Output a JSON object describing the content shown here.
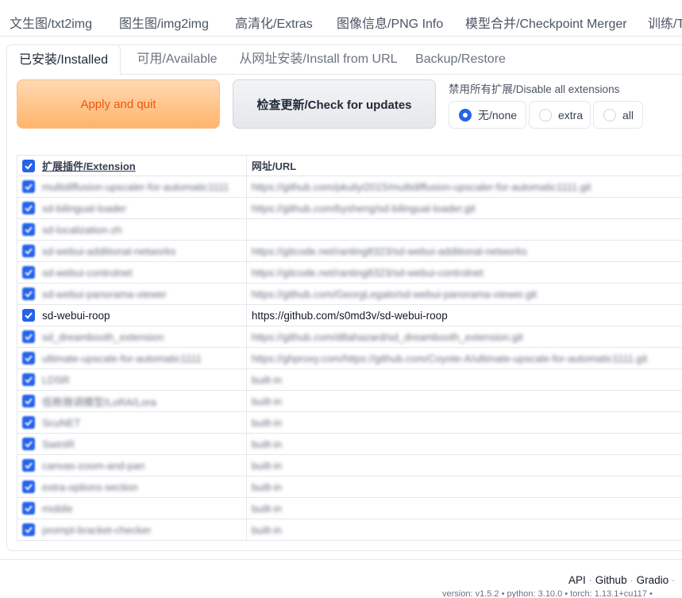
{
  "top_tabs": [
    "文生图/txt2img",
    "图生图/img2img",
    "高清化/Extras",
    "图像信息/PNG Info",
    "模型合并/Checkpoint Merger",
    "训练/T"
  ],
  "sub_tabs": [
    {
      "label": "已安装/Installed",
      "active": true
    },
    {
      "label": "可用/Available",
      "active": false
    },
    {
      "label": "从网址安装/Install from URL",
      "active": false
    },
    {
      "label": "Backup/Restore",
      "active": false
    }
  ],
  "actions": {
    "apply_label": "Apply and quit",
    "check_label": "检查更新/Check for updates"
  },
  "disable": {
    "label": "禁用所有扩展/Disable all extensions",
    "options": [
      {
        "label": "无/none",
        "checked": true
      },
      {
        "label": "extra",
        "checked": false
      },
      {
        "label": "all",
        "checked": false
      }
    ]
  },
  "table": {
    "header_checked": true,
    "col_extension": "扩展插件/Extension",
    "col_url": "网址/URL",
    "rows": [
      {
        "name": "multidiffusion-upscaler-for-automatic1111",
        "url": "https://github.com/pkuliyi2015/multidiffusion-upscaler-for-automatic1111.git",
        "checked": true,
        "blurred": true
      },
      {
        "name": "sd-bilingual-loader",
        "url": "https://github.com/bysheng/sd-bilingual-loader.git",
        "checked": true,
        "blurred": true
      },
      {
        "name": "sd-localization-zh",
        "url": "",
        "checked": true,
        "blurred": true
      },
      {
        "name": "sd-webui-additional-networks",
        "url": "https://gitcode.net/ranting8323/sd-webui-additional-networks",
        "checked": true,
        "blurred": true
      },
      {
        "name": "sd-webui-controlnet",
        "url": "https://gitcode.net/ranting8323/sd-webui-controlnet",
        "checked": true,
        "blurred": true
      },
      {
        "name": "sd-webui-panorama-viewer",
        "url": "https://github.com/GeorgLegato/sd-webui-panorama-viewer.git",
        "checked": true,
        "blurred": true
      },
      {
        "name": "sd-webui-roop",
        "url": "https://github.com/s0md3v/sd-webui-roop",
        "checked": true,
        "blurred": false
      },
      {
        "name": "sd_dreambooth_extension",
        "url": "https://github.com/d8ahazard/sd_dreambooth_extension.git",
        "checked": true,
        "blurred": true
      },
      {
        "name": "ultimate-upscale-for-automatic1111",
        "url": "https://ghproxy.com/https://github.com/Coyote-A/ultimate-upscale-for-automatic1111.git",
        "checked": true,
        "blurred": true
      },
      {
        "name": "LDSR",
        "url": "built-in",
        "checked": true,
        "blurred": true
      },
      {
        "name": "低秩微调模型/LoRA/Lora",
        "url": "built-in",
        "checked": true,
        "blurred": true
      },
      {
        "name": "ScuNET",
        "url": "built-in",
        "checked": true,
        "blurred": true
      },
      {
        "name": "SwinIR",
        "url": "built-in",
        "checked": true,
        "blurred": true
      },
      {
        "name": "canvas-zoom-and-pan",
        "url": "built-in",
        "checked": true,
        "blurred": true
      },
      {
        "name": "extra-options-section",
        "url": "built-in",
        "checked": true,
        "blurred": true
      },
      {
        "name": "mobile",
        "url": "built-in",
        "checked": true,
        "blurred": true
      },
      {
        "name": "prompt-bracket-checker",
        "url": "built-in",
        "checked": true,
        "blurred": true
      }
    ]
  },
  "footer": {
    "links": [
      "API",
      "Github",
      "Gradio"
    ],
    "separator": "·",
    "versions": "version: v1.5.2  •  python: 3.10.0  •  torch: 1.13.1+cu117  •"
  },
  "colors": {
    "accent": "#2563eb",
    "primary_text": "#ea580c"
  }
}
